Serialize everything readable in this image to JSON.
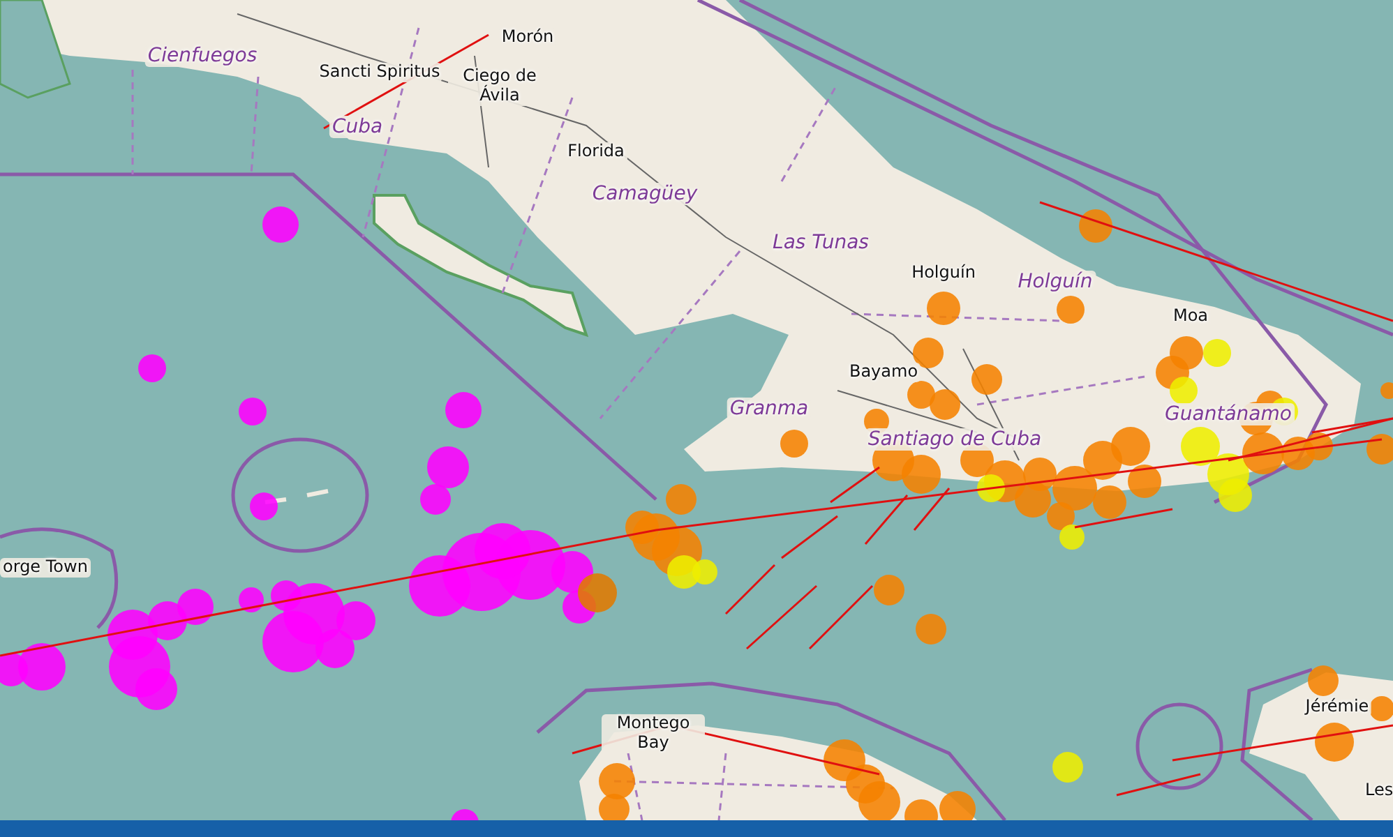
{
  "map": {
    "labels": [
      {
        "text": "Cienfuegos",
        "kind": "region"
      },
      {
        "text": "Morón",
        "kind": "city"
      },
      {
        "text": "Sancti Spiritus",
        "kind": "city"
      },
      {
        "text": "Ciego de Ávila",
        "kind": "city"
      },
      {
        "text": "Cuba",
        "kind": "region"
      },
      {
        "text": "Florida",
        "kind": "city"
      },
      {
        "text": "Camagüey",
        "kind": "region"
      },
      {
        "text": "Las Tunas",
        "kind": "region"
      },
      {
        "text": "Holguín",
        "kind": "city"
      },
      {
        "text": "Holguín",
        "kind": "region"
      },
      {
        "text": "Moa",
        "kind": "city"
      },
      {
        "text": "Bayamo",
        "kind": "city"
      },
      {
        "text": "Granma",
        "kind": "region"
      },
      {
        "text": "Santiago de Cuba",
        "kind": "region"
      },
      {
        "text": "Guantánamo",
        "kind": "region"
      },
      {
        "text": "orge Town",
        "kind": "city"
      },
      {
        "text": "Montego Bay",
        "kind": "city"
      },
      {
        "text": "Jérémie",
        "kind": "city"
      },
      {
        "text": "Les",
        "kind": "city"
      }
    ]
  }
}
